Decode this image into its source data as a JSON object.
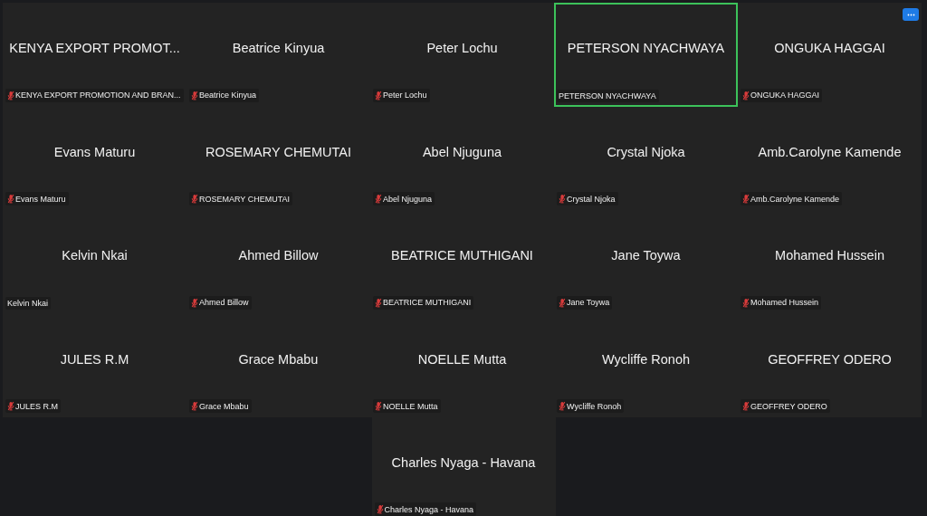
{
  "tiles": [
    {
      "display_name": "KENYA EXPORT PROMOT...",
      "label": "KENYA EXPORT PROMOTION AND BRAN...",
      "muted": true,
      "speaking": false
    },
    {
      "display_name": "Beatrice Kinyua",
      "label": "Beatrice Kinyua",
      "muted": true,
      "speaking": false
    },
    {
      "display_name": "Peter Lochu",
      "label": "Peter Lochu",
      "muted": true,
      "speaking": false
    },
    {
      "display_name": "PETERSON NYACHWAYA",
      "label": "PETERSON NYACHWAYA",
      "muted": false,
      "speaking": true
    },
    {
      "display_name": "ONGUKA HAGGAI",
      "label": "ONGUKA HAGGAI",
      "muted": true,
      "speaking": false
    },
    {
      "display_name": "Evans Maturu",
      "label": "Evans Maturu",
      "muted": true,
      "speaking": false
    },
    {
      "display_name": "ROSEMARY CHEMUTAI",
      "label": "ROSEMARY CHEMUTAI",
      "muted": true,
      "speaking": false
    },
    {
      "display_name": "Abel Njuguna",
      "label": "Abel Njuguna",
      "muted": true,
      "speaking": false
    },
    {
      "display_name": "Crystal Njoka",
      "label": "Crystal Njoka",
      "muted": true,
      "speaking": false
    },
    {
      "display_name": "Amb.Carolyne Kamende",
      "label": "Amb.Carolyne Kamende",
      "muted": true,
      "speaking": false
    },
    {
      "display_name": "Kelvin Nkai",
      "label": "Kelvin Nkai",
      "muted": false,
      "speaking": false
    },
    {
      "display_name": "Ahmed Billow",
      "label": "Ahmed Billow",
      "muted": true,
      "speaking": false
    },
    {
      "display_name": "BEATRICE MUTHIGANI",
      "label": "BEATRICE MUTHIGANI",
      "muted": true,
      "speaking": false
    },
    {
      "display_name": "Jane Toywa",
      "label": "Jane Toywa",
      "muted": true,
      "speaking": false
    },
    {
      "display_name": "Mohamed Hussein",
      "label": "Mohamed Hussein",
      "muted": true,
      "speaking": false
    },
    {
      "display_name": "JULES R.M",
      "label": "JULES R.M",
      "muted": true,
      "speaking": false
    },
    {
      "display_name": "Grace Mbabu",
      "label": "Grace Mbabu",
      "muted": true,
      "speaking": false
    },
    {
      "display_name": "NOELLE Mutta",
      "label": "NOELLE Mutta",
      "muted": true,
      "speaking": false
    },
    {
      "display_name": "Wycliffe Ronoh",
      "label": "Wycliffe Ronoh",
      "muted": true,
      "speaking": false
    },
    {
      "display_name": "GEOFFREY ODERO",
      "label": "GEOFFREY ODERO",
      "muted": true,
      "speaking": false
    }
  ],
  "overflow_tiles": [
    {
      "display_name": "Charles Nyaga - Havana",
      "label": "Charles Nyaga - Havana",
      "muted": true,
      "speaking": false
    }
  ]
}
